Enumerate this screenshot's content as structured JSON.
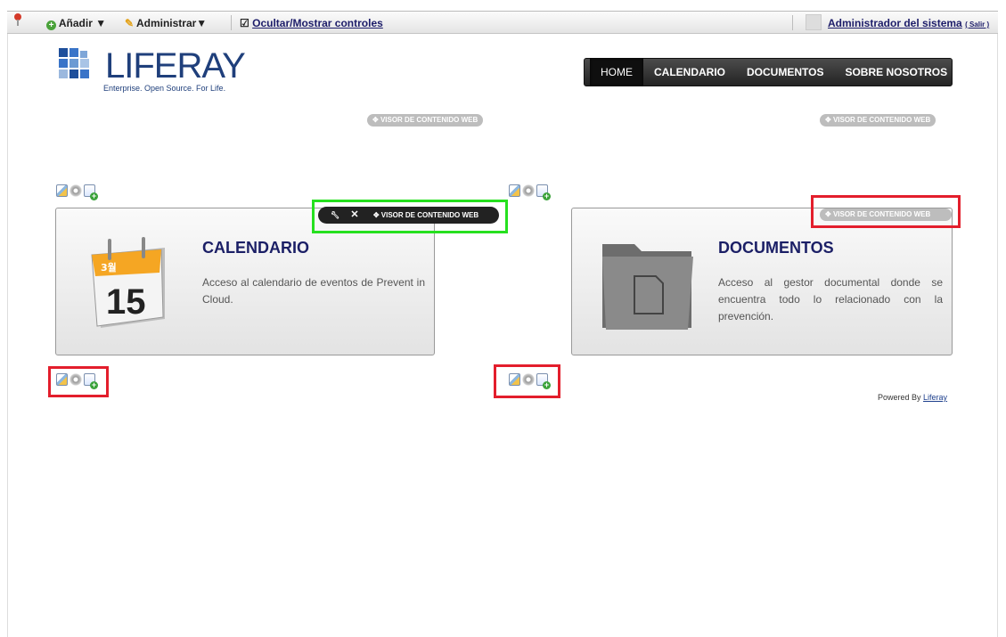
{
  "dockbar": {
    "add_label": "Añadir ▼",
    "manage_label": "Administrar▼",
    "toggle_label": "Ocultar/Mostrar controles",
    "user_name": "Administrador del sistema",
    "logout_label": "( Salir )"
  },
  "logo": {
    "text": "LIFERAY",
    "tagline": "Enterprise. Open Source. For Life."
  },
  "nav": {
    "items": [
      "HOME",
      "CALENDARIO",
      "DOCUMENTOS",
      "SOBRE NOSOTROS"
    ]
  },
  "portlet_label": "VISOR DE CONTENIDO WEB",
  "calendar": {
    "title": "CALENDARIO",
    "text": "Acceso al calendario de eventos de Prevent in Cloud.",
    "icon_day": "15",
    "icon_month": "3월"
  },
  "documents": {
    "title": "DOCUMENTOS",
    "text": "Acceso al gestor documental donde se encuentra todo lo relacionado con la prevención."
  },
  "footer": {
    "prefix": "Powered By ",
    "link": "Liferay"
  },
  "colors": {
    "highlight_red": "#e31e2c",
    "highlight_green": "#26e01f",
    "title_blue": "#1b1f66"
  }
}
